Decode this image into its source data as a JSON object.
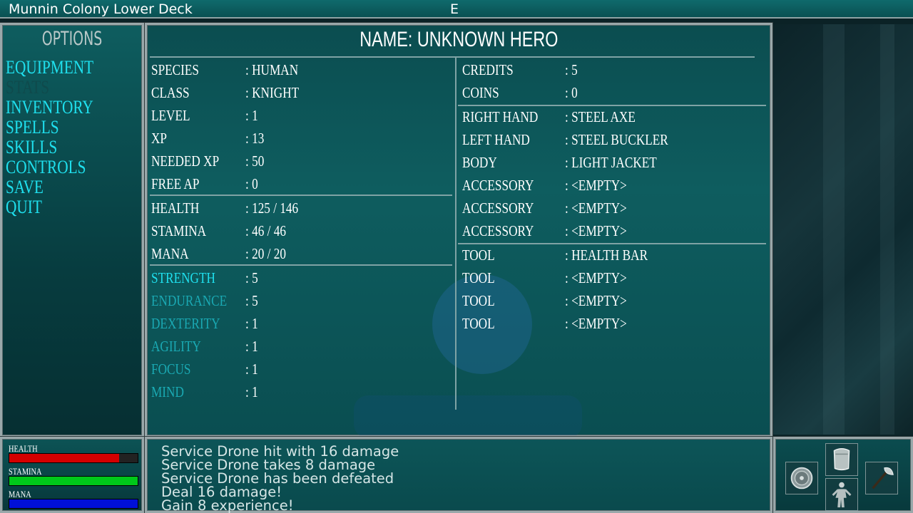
{
  "top": {
    "location": "Munnin Colony Lower Deck",
    "direction": "E"
  },
  "options": {
    "title": "OPTIONS",
    "items": [
      {
        "label": "EQUIPMENT",
        "enabled": true
      },
      {
        "label": "STATS",
        "enabled": false
      },
      {
        "label": "INVENTORY",
        "enabled": true
      },
      {
        "label": "SPELLS",
        "enabled": true
      },
      {
        "label": "SKILLS",
        "enabled": true
      },
      {
        "label": "CONTROLS",
        "enabled": true
      },
      {
        "label": "SAVE",
        "enabled": true
      },
      {
        "label": "QUIT",
        "enabled": true
      }
    ]
  },
  "hero": {
    "name": "NAME: UNKNOWN HERO",
    "info": [
      {
        "label": "SPECIES",
        "value": ": HUMAN"
      },
      {
        "label": "CLASS",
        "value": ": KNIGHT"
      },
      {
        "label": "LEVEL",
        "value": ": 1"
      },
      {
        "label": "XP",
        "value": ": 13"
      },
      {
        "label": "NEEDED XP",
        "value": ": 50"
      },
      {
        "label": "FREE AP",
        "value": ": 0"
      }
    ],
    "vitals": [
      {
        "label": "HEALTH",
        "value": ": 125 / 146"
      },
      {
        "label": "STAMINA",
        "value": ": 46 / 46"
      },
      {
        "label": "MANA",
        "value": ": 20 / 20"
      }
    ],
    "attributes": [
      {
        "label": "STRENGTH",
        "value": ": 5"
      },
      {
        "label": "ENDURANCE",
        "value": ": 5"
      },
      {
        "label": "DEXTERITY",
        "value": ": 1"
      },
      {
        "label": "AGILITY",
        "value": ": 1"
      },
      {
        "label": "FOCUS",
        "value": ": 1"
      },
      {
        "label": "MIND",
        "value": ": 1"
      }
    ],
    "money": [
      {
        "label": "CREDITS",
        "value": ": 5"
      },
      {
        "label": "COINS",
        "value": ": 0"
      }
    ],
    "equipment": [
      {
        "label": "RIGHT HAND",
        "value": ": STEEL AXE"
      },
      {
        "label": "LEFT HAND",
        "value": ": STEEL BUCKLER"
      },
      {
        "label": "BODY",
        "value": ": LIGHT JACKET"
      },
      {
        "label": "ACCESSORY",
        "value": ": <EMPTY>"
      },
      {
        "label": "ACCESSORY",
        "value": ": <EMPTY>"
      },
      {
        "label": "ACCESSORY",
        "value": ": <EMPTY>"
      }
    ],
    "tools": [
      {
        "label": "TOOL",
        "value": ": HEALTH BAR"
      },
      {
        "label": "TOOL",
        "value": ": <EMPTY>"
      },
      {
        "label": "TOOL",
        "value": ": <EMPTY>"
      },
      {
        "label": "TOOL",
        "value": ": <EMPTY>"
      }
    ]
  },
  "bars": {
    "health": {
      "label": "HEALTH",
      "fraction": 0.856,
      "color": "#d40000"
    },
    "stamina": {
      "label": "STAMINA",
      "fraction": 1.0,
      "color": "#00c81a"
    },
    "mana": {
      "label": "MANA",
      "fraction": 1.0,
      "color": "#0010d8"
    }
  },
  "log": [
    "Service Drone hit with 16 damage",
    "Service Drone takes 8 damage",
    "Service Drone has been defeated",
    "Deal 16 damage!",
    "Gain 8 experience!"
  ],
  "slots": {
    "left_hand": "shield-icon",
    "body": "armor-icon",
    "figure": "character-figure-icon",
    "right_hand": "axe-icon"
  }
}
